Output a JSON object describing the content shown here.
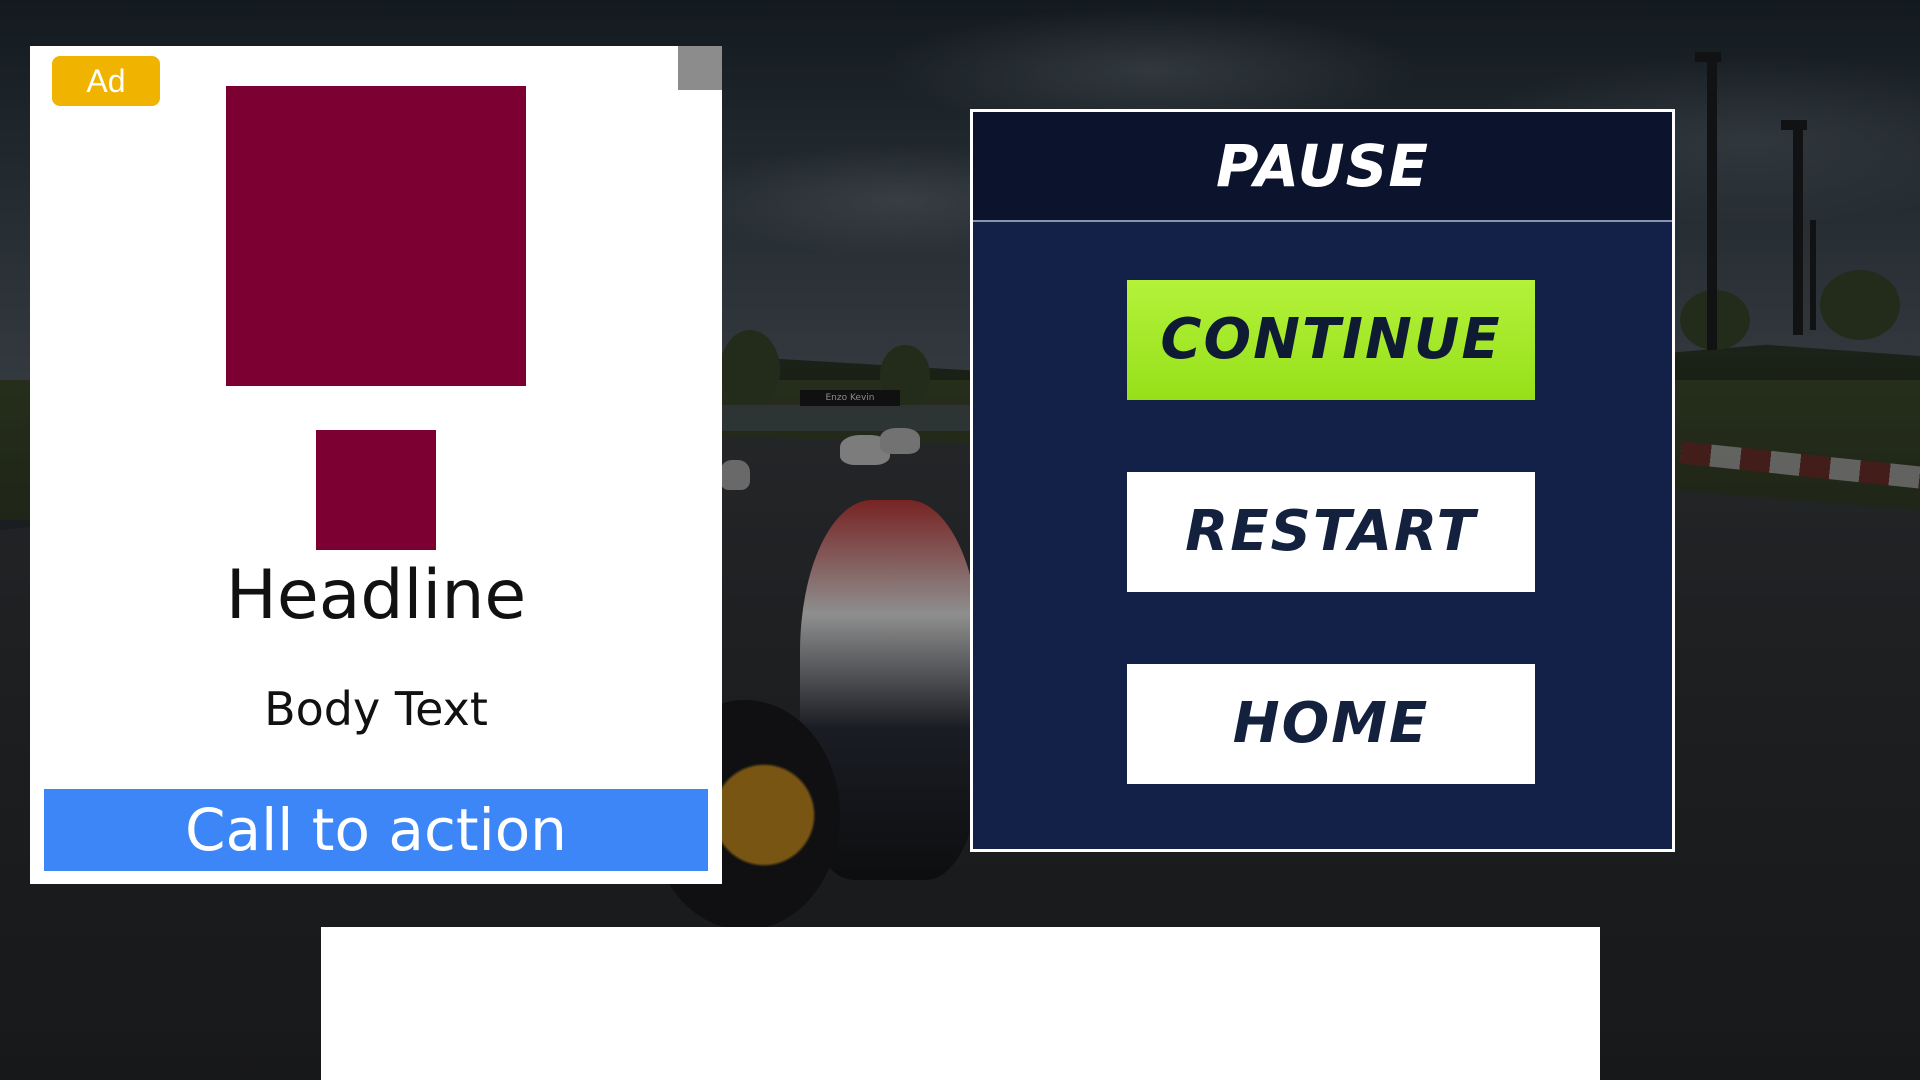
{
  "ad": {
    "badge_label": "Ad",
    "headline": "Headline",
    "body_text": "Body Text",
    "cta_label": "Call to action",
    "media_color": "#7d0032",
    "cta_color": "#3d86f7",
    "badge_color": "#f0b400"
  },
  "scene": {
    "sign_text": "Enzo      Kevin"
  },
  "pause_menu": {
    "title": "PAUSE",
    "buttons": {
      "continue_label": "CONTINUE",
      "restart_label": "RESTART",
      "home_label": "HOME"
    },
    "accent_color": "#a6ea2a",
    "panel_color": "#132148"
  }
}
